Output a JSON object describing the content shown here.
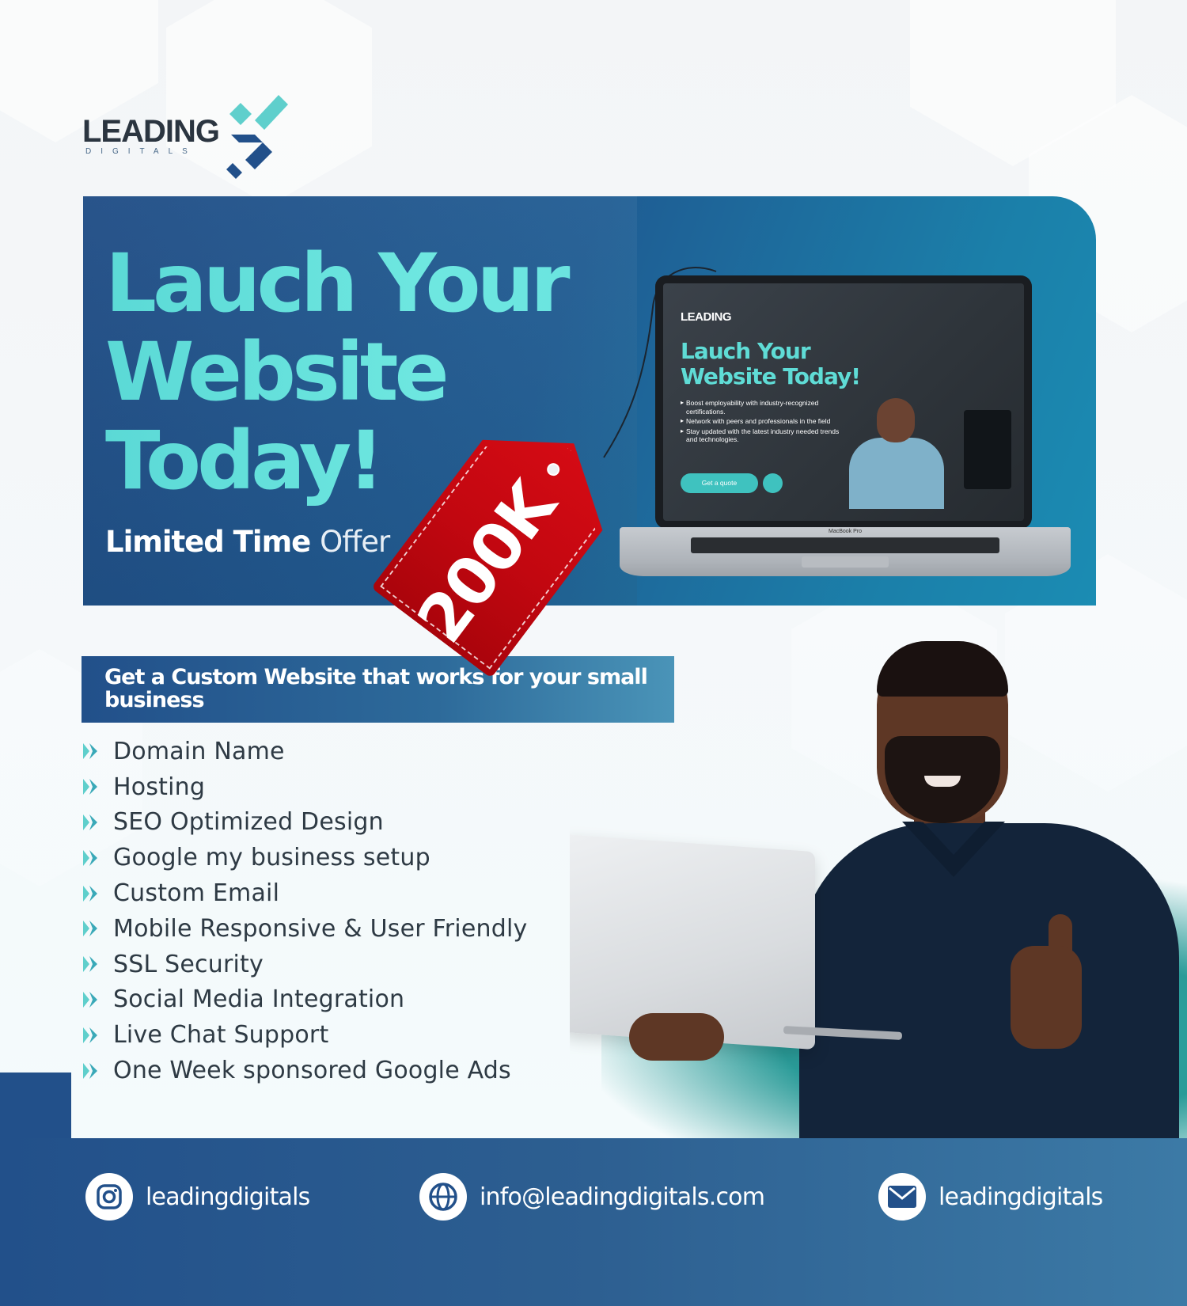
{
  "brand": {
    "name": "LEADING",
    "sub": "DIGITALS"
  },
  "hero": {
    "headline": "Lauch Your\nWebsite\nToday!",
    "offer_main": "Limited Time",
    "offer_soft": "Offer",
    "price_tag": "200K"
  },
  "laptop_screen": {
    "logo": "LEADING",
    "title": "Lauch Your\nWebsite Today!",
    "bullets": [
      "Boost employability with industry-recognized certifications.",
      "Network with peers and professionals in the field",
      "Stay updated with the latest industry needed trends and technologies."
    ],
    "button": "Get a quote",
    "model": "MacBook Pro"
  },
  "subheading": "Get a Custom Website that works for your small business",
  "features": [
    "Domain Name",
    "Hosting",
    "SEO Optimized Design",
    "Google my business setup",
    "Custom Email",
    "Mobile Responsive & User Friendly",
    "SSL Security",
    "Social Media Integration",
    "Live Chat Support",
    "One Week sponsored Google Ads"
  ],
  "footer": {
    "instagram": "leadingdigitals",
    "website": "info@leadingdigitals.com",
    "email": "leadingdigitals"
  },
  "colors": {
    "brand_blue": "#22508a",
    "teal": "#5bd9d6",
    "tag_red": "#d50b14",
    "text_dark": "#2e3a44"
  },
  "icons": [
    "logo-mark-icon",
    "chevron-right-icon",
    "instagram-icon",
    "globe-icon",
    "mail-icon"
  ]
}
